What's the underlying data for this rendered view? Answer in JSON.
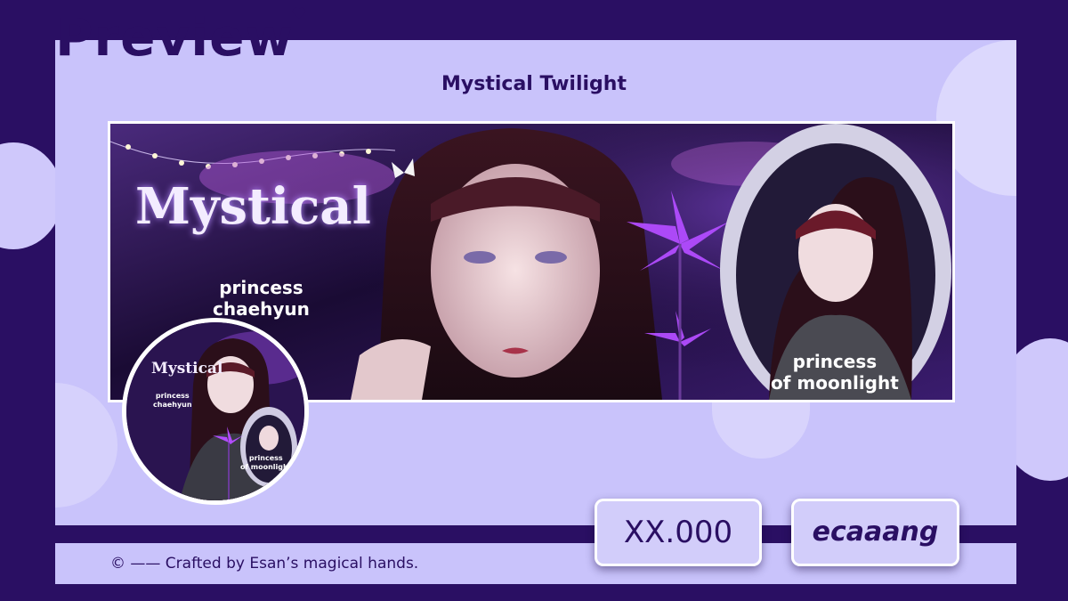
{
  "header": {
    "preview_label": "Preview",
    "design_title": "Mystical Twilight"
  },
  "banner": {
    "script_title": "Mystical",
    "left_caption_line1": "princess",
    "left_caption_line2": "chaehyun",
    "right_caption_line1": "princess",
    "right_caption_line2": "of moonlight"
  },
  "thumbnail": {
    "script_title": "Mystical",
    "left_caption_line1": "princess",
    "left_caption_line2": "chaehyun",
    "right_caption_line1": "princess",
    "right_caption_line2": "of moonlight"
  },
  "price_tag": {
    "label": "XX.000"
  },
  "creator_tag": {
    "label": "ecaaang"
  },
  "footer": {
    "credit": "© —— Crafted by Esan’s magical hands."
  },
  "colors": {
    "dark_purple": "#2a0f63",
    "lavender": "#c9c3fb",
    "white": "#ffffff",
    "flower": "#b24cff"
  }
}
